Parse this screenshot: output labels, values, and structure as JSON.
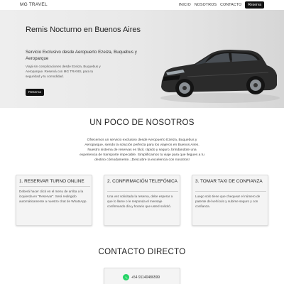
{
  "nav": {
    "brand": "MG TRAVEL",
    "links": [
      "INICIO",
      "NOSOTROS",
      "CONTACTO"
    ],
    "cta": "Reserva"
  },
  "hero": {
    "title": "Remis Nocturno en Buenos Aires",
    "subtitle": "Servicio Exclusivo desde Aeropuerto Ezeiza, Buquebus y Aeroparque",
    "text": "Viajá sin complicaciones desde Ezeiza, Buquebus y Aeroparque. Reservá con MG TRAVEL para tu seguridad y tu comodidad.",
    "button": "Reserva",
    "car_color": "#2b2b2b"
  },
  "about": {
    "title": "UN POCO DE NOSOTROS",
    "text": "Ofrecemos un servicio exclusivo desde Aeropuerto Ezeiza, Buquebus y Aeroparque, siendo la solución perfecta para los viajeros en Buenos Aires. Nuestro sistema de reservas es fácil, rápido y seguro, brindándote una experiencia de transporte impecable. Simplificamos tu viaje para que llegues a tu destino cómodamente. ¡Descubre la excelencia con nosotros!"
  },
  "cards": [
    {
      "title": "1. RESERVAR TURNO ONLINE",
      "text": "Deberá hacer click en el menu de arriba a la izquierda en \"Reservar\". Será redirigido automáticamente a nuestro chat de WhatsApp."
    },
    {
      "title": "2. CONFIRMACIÓN TELEFÓNICA",
      "text": "Una vez solicitada la reserva, debe esperar a que lo llame o le responda el mensaje confirmando día y horario que usted solicitó."
    },
    {
      "title": "3. TOMAR TAXI DE CONFIANZA",
      "text": "Luego solo tiene que chequear el número de patente del vehículo y subirse seguro y con confianza."
    }
  ],
  "contact": {
    "title": "CONTACTO DIRECTO",
    "phone": "+54 91140486599",
    "whatsapp_color": "#25d366"
  }
}
